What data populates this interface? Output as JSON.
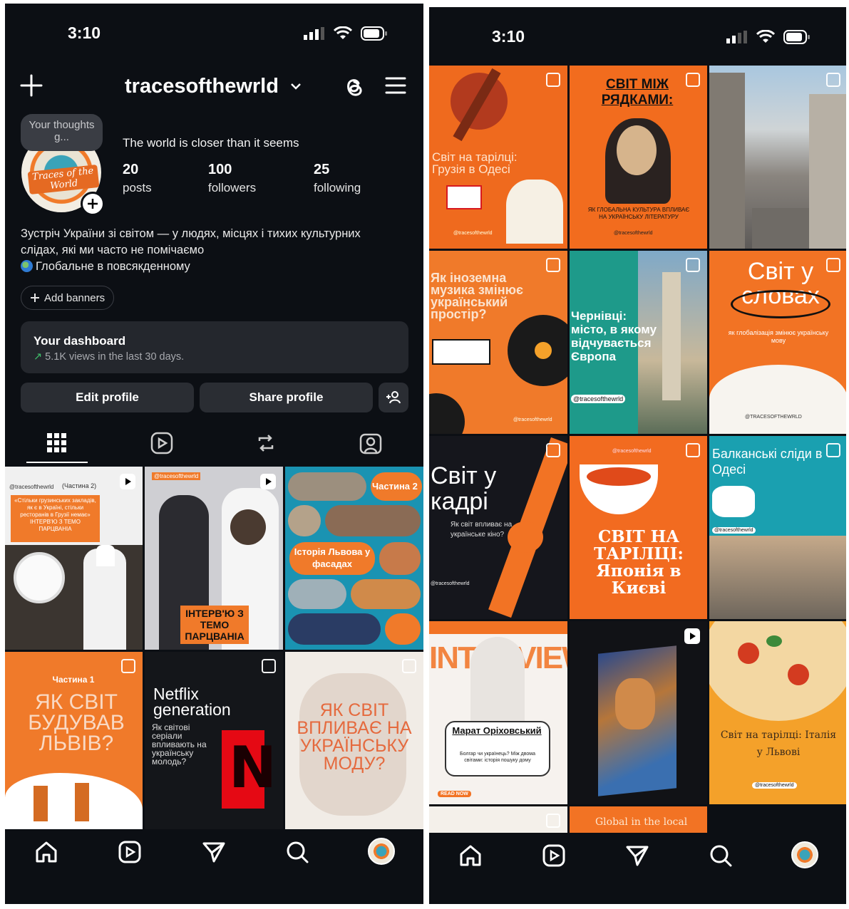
{
  "left": {
    "status": {
      "time": "3:10"
    },
    "header": {
      "username": "tracesofthewrld"
    },
    "profile": {
      "note": "Your thoughts g...",
      "avatar_text": "Traces of the World",
      "bio_title": "The world is closer than it seems",
      "stats": [
        {
          "value": "20",
          "label": "posts"
        },
        {
          "value": "100",
          "label": "followers"
        },
        {
          "value": "25",
          "label": "following"
        }
      ],
      "bio_line1": "Зустріч України зі світом — у людях, місцях і тихих культурних",
      "bio_line2": "слідах, які ми часто не помічаємо",
      "bio_line3": "Глобальне в повсякденному",
      "add_banners": "Add banners",
      "dashboard_title": "Your dashboard",
      "dashboard_sub": "5.1K views in the last 30 days.",
      "edit_profile": "Edit profile",
      "share_profile": "Share profile"
    },
    "tiles": [
      {
        "title": "«Стільки грузинських закладів, як є в Україні, стільки ресторанів в Грузії немає» ІНТЕРВ'Ю З ТЕМО ПАРЦВАНІА",
        "tag": "@tracesofthewrld",
        "part": "(Частина 2)",
        "bg": "#3b3530"
      },
      {
        "title": "ІНТЕРВ'Ю З ТЕМО ПАРЦВАНІА",
        "tag": "@tracesofthewrld",
        "bg": "#cfcfd3"
      },
      {
        "title": "Історія Львова у фасадах",
        "tag": "Частина 2",
        "bg": "#1a93b2"
      },
      {
        "title": "ЯК СВІТ БУДУВАВ ЛЬВІВ?",
        "tag": "Частина 1",
        "bg": "#f07a2a"
      },
      {
        "title": "Netflix generation",
        "sub": "Як світові серіали впливають на українську молодь?",
        "bg": "#14161a"
      },
      {
        "title": "ЯК СВІТ ВПЛИВАЄ НА УКРАЇНСЬКУ МОДУ?",
        "bg": "#f1ece6"
      }
    ]
  },
  "right": {
    "status": {
      "time": "3:10"
    },
    "tiles": [
      {
        "title": "Світ на тарілці: Грузія в Одесі",
        "tag": "@tracesofthewrld",
        "bg": "#ef6a1e"
      },
      {
        "title": "СВІТ МІЖ РЯДКАМИ:",
        "sub": "ЯК ГЛОБАЛЬНА КУЛЬТУРА ВПЛИВАЄ НА УКРАЇНСЬКУ ЛІТЕРАТУРУ",
        "tag": "@tracesofthewrld",
        "bg": "#f26c1e"
      },
      {
        "title": "",
        "bg": "#8d8a86"
      },
      {
        "title": "Як іноземна музика змінює український простір?",
        "tag": "@tracesofthewrld",
        "bg": "#f07a2a"
      },
      {
        "title": "Чернівці: місто, в якому відчувається Європа",
        "tag": "@tracesofthewrld",
        "bg": "#1e9a8a"
      },
      {
        "title": "Світ у словах",
        "sub": "як глобалізація змінює українську мову",
        "tag": "@TRACESOFTHEWRLD",
        "bg": "#f27324"
      },
      {
        "title": "Світ у кадрі",
        "sub": "Як світ впливає на українське кіно?",
        "tag": "@tracesofthewrld",
        "bg": "#15161c"
      },
      {
        "title": "СВІТ НА ТАРІЛЦІ: Японія в Києві",
        "tag": "@tracesofthewrld",
        "bg": "#f26b20"
      },
      {
        "title": "Балканські сліди в Одесі",
        "tag": "@tracesofthewrld",
        "bg": "#1aa0b0"
      },
      {
        "title": "INTERVIEW",
        "name": "Марат Оріховський",
        "sub": "Болгар чи українець? Між двома світами: історія пошуку дому",
        "badge": "READ NOW",
        "bg": "#f6f2ee"
      },
      {
        "title": "",
        "bg": "#111216"
      },
      {
        "title": "Світ на тарілці: Італія у Львові",
        "tag": "@tracesofthewrld",
        "bg": "#f4a12a"
      },
      {
        "title": "",
        "bg": "#f4f0ea"
      },
      {
        "title": "Global in the local",
        "bg": "#f27324"
      }
    ]
  }
}
